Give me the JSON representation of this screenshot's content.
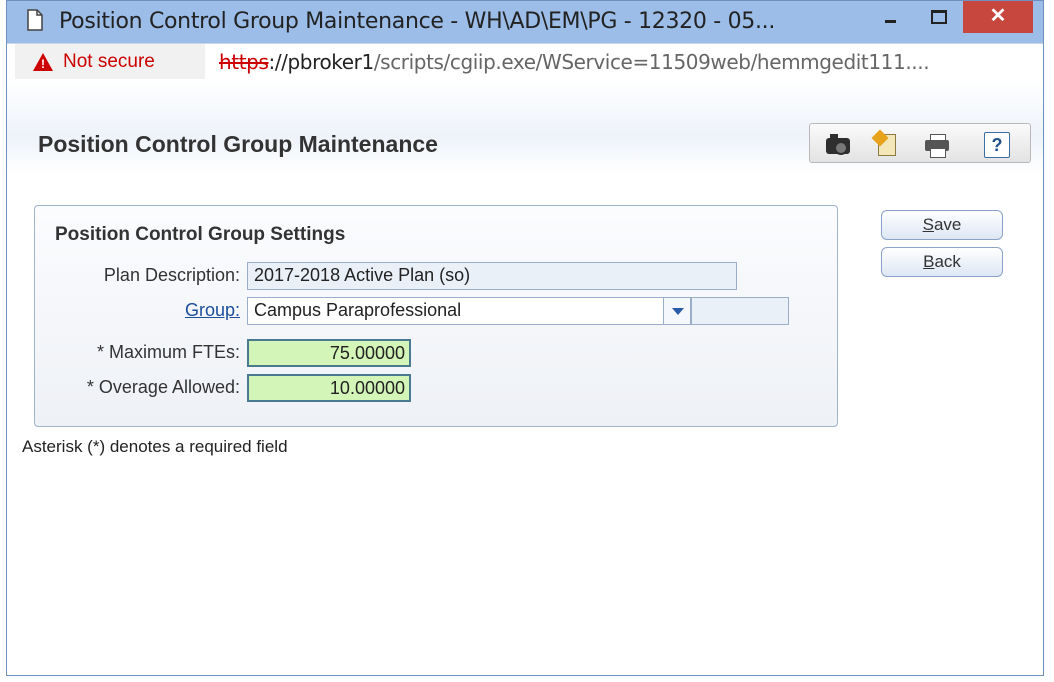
{
  "window": {
    "title": "Position Control Group Maintenance - WH\\AD\\EM\\PG - 12320 - 05...",
    "close_glyph": "✕"
  },
  "address_bar": {
    "security_label": "Not secure",
    "url_protocol": "https",
    "url_host": "://pbroker1",
    "url_path": "/scripts/cgiip.exe/WService=11509web/hemmgedit111...."
  },
  "page": {
    "title": "Position Control Group Maintenance"
  },
  "toolbar": {
    "icons": [
      "camera-icon",
      "new-note-icon",
      "print-icon",
      "help-icon"
    ],
    "help_glyph": "?"
  },
  "settings": {
    "title": "Position Control Group Settings",
    "plan_label": "Plan Description:",
    "plan_value": "2017-2018 Active Plan (so)",
    "group_label": "Group:",
    "group_value": "Campus Paraprofessional",
    "max_label": "* Maximum FTEs:",
    "max_value": "75.00000",
    "overage_label": "* Overage Allowed:",
    "overage_value": "10.00000"
  },
  "buttons": {
    "save_accel": "S",
    "save_rest": "ave",
    "back_accel": "B",
    "back_rest": "ack"
  },
  "footer_note": "Asterisk (*) denotes a required field",
  "colors": {
    "required_field_bg": "#d3f5b8",
    "link": "#1b4f9c",
    "close_button": "#c7463e",
    "warning": "#cc0000"
  }
}
